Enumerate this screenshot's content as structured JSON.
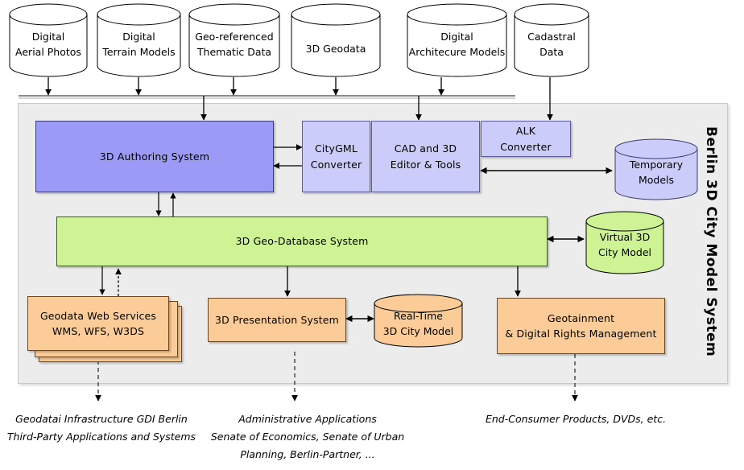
{
  "title": "Berlin 3D City Model System",
  "side_label": "Berlin 3D City Model System",
  "sources": [
    {
      "id": "digital-aerial-photos",
      "line1": "Digital",
      "line2": "Aerial Photos"
    },
    {
      "id": "digital-terrain-models",
      "line1": "Digital",
      "line2": "Terrain Models"
    },
    {
      "id": "geo-referenced-thematic-data",
      "line1": "Geo-referenced",
      "line2": "Thematic Data"
    },
    {
      "id": "3d-geodata",
      "line1": "3D Geodata",
      "line2": ""
    },
    {
      "id": "digital-architecure-models",
      "line1": "Digital",
      "line2": "Architecure Models"
    },
    {
      "id": "cadastral-data",
      "line1": "Cadastral",
      "line2": "Data"
    }
  ],
  "nodes": {
    "authoring": {
      "label": "3D Authoring System"
    },
    "citygml": {
      "line1": "CityGML",
      "line2": "Converter"
    },
    "cad": {
      "line1": "CAD and 3D",
      "line2": "Editor & Tools"
    },
    "alk": {
      "line1": "ALK",
      "line2": "Converter"
    },
    "temporary_models": {
      "line1": "Temporary",
      "line2": "Models"
    },
    "geodb": {
      "label": "3D Geo-Database System"
    },
    "virtual_city_model": {
      "line1": "Virtual 3D",
      "line2": "City Model"
    },
    "geodata_web_services": {
      "line1": "Geodata Web Services",
      "line2": "WMS, WFS, W3DS"
    },
    "presentation": {
      "label": "3D Presentation System"
    },
    "realtime_city_model": {
      "line1": "Real-Time",
      "line2": "3D City Model"
    },
    "geotainment": {
      "line1": "Geotainment",
      "line2": "& Digital Rights Management"
    }
  },
  "captions": [
    {
      "id": "gdi-berlin",
      "text": "Geodatai Infrastructure GDI Berlin\nThird-Party Applications and Systems"
    },
    {
      "id": "administrative-applications",
      "text": "Administrative Applications\nSenate of Economics, Senate of Urban\nPlanning, Berlin-Partner, ..."
    },
    {
      "id": "end-consumer-products",
      "text": "End-Consumer Products, DVDs, etc."
    }
  ],
  "colors": {
    "authoring": "#9b9bf7",
    "converter": "#ccccfa",
    "database": "#cdf394",
    "application": "#fbcc97",
    "panel": "#ececec",
    "stroke": "#000000"
  }
}
